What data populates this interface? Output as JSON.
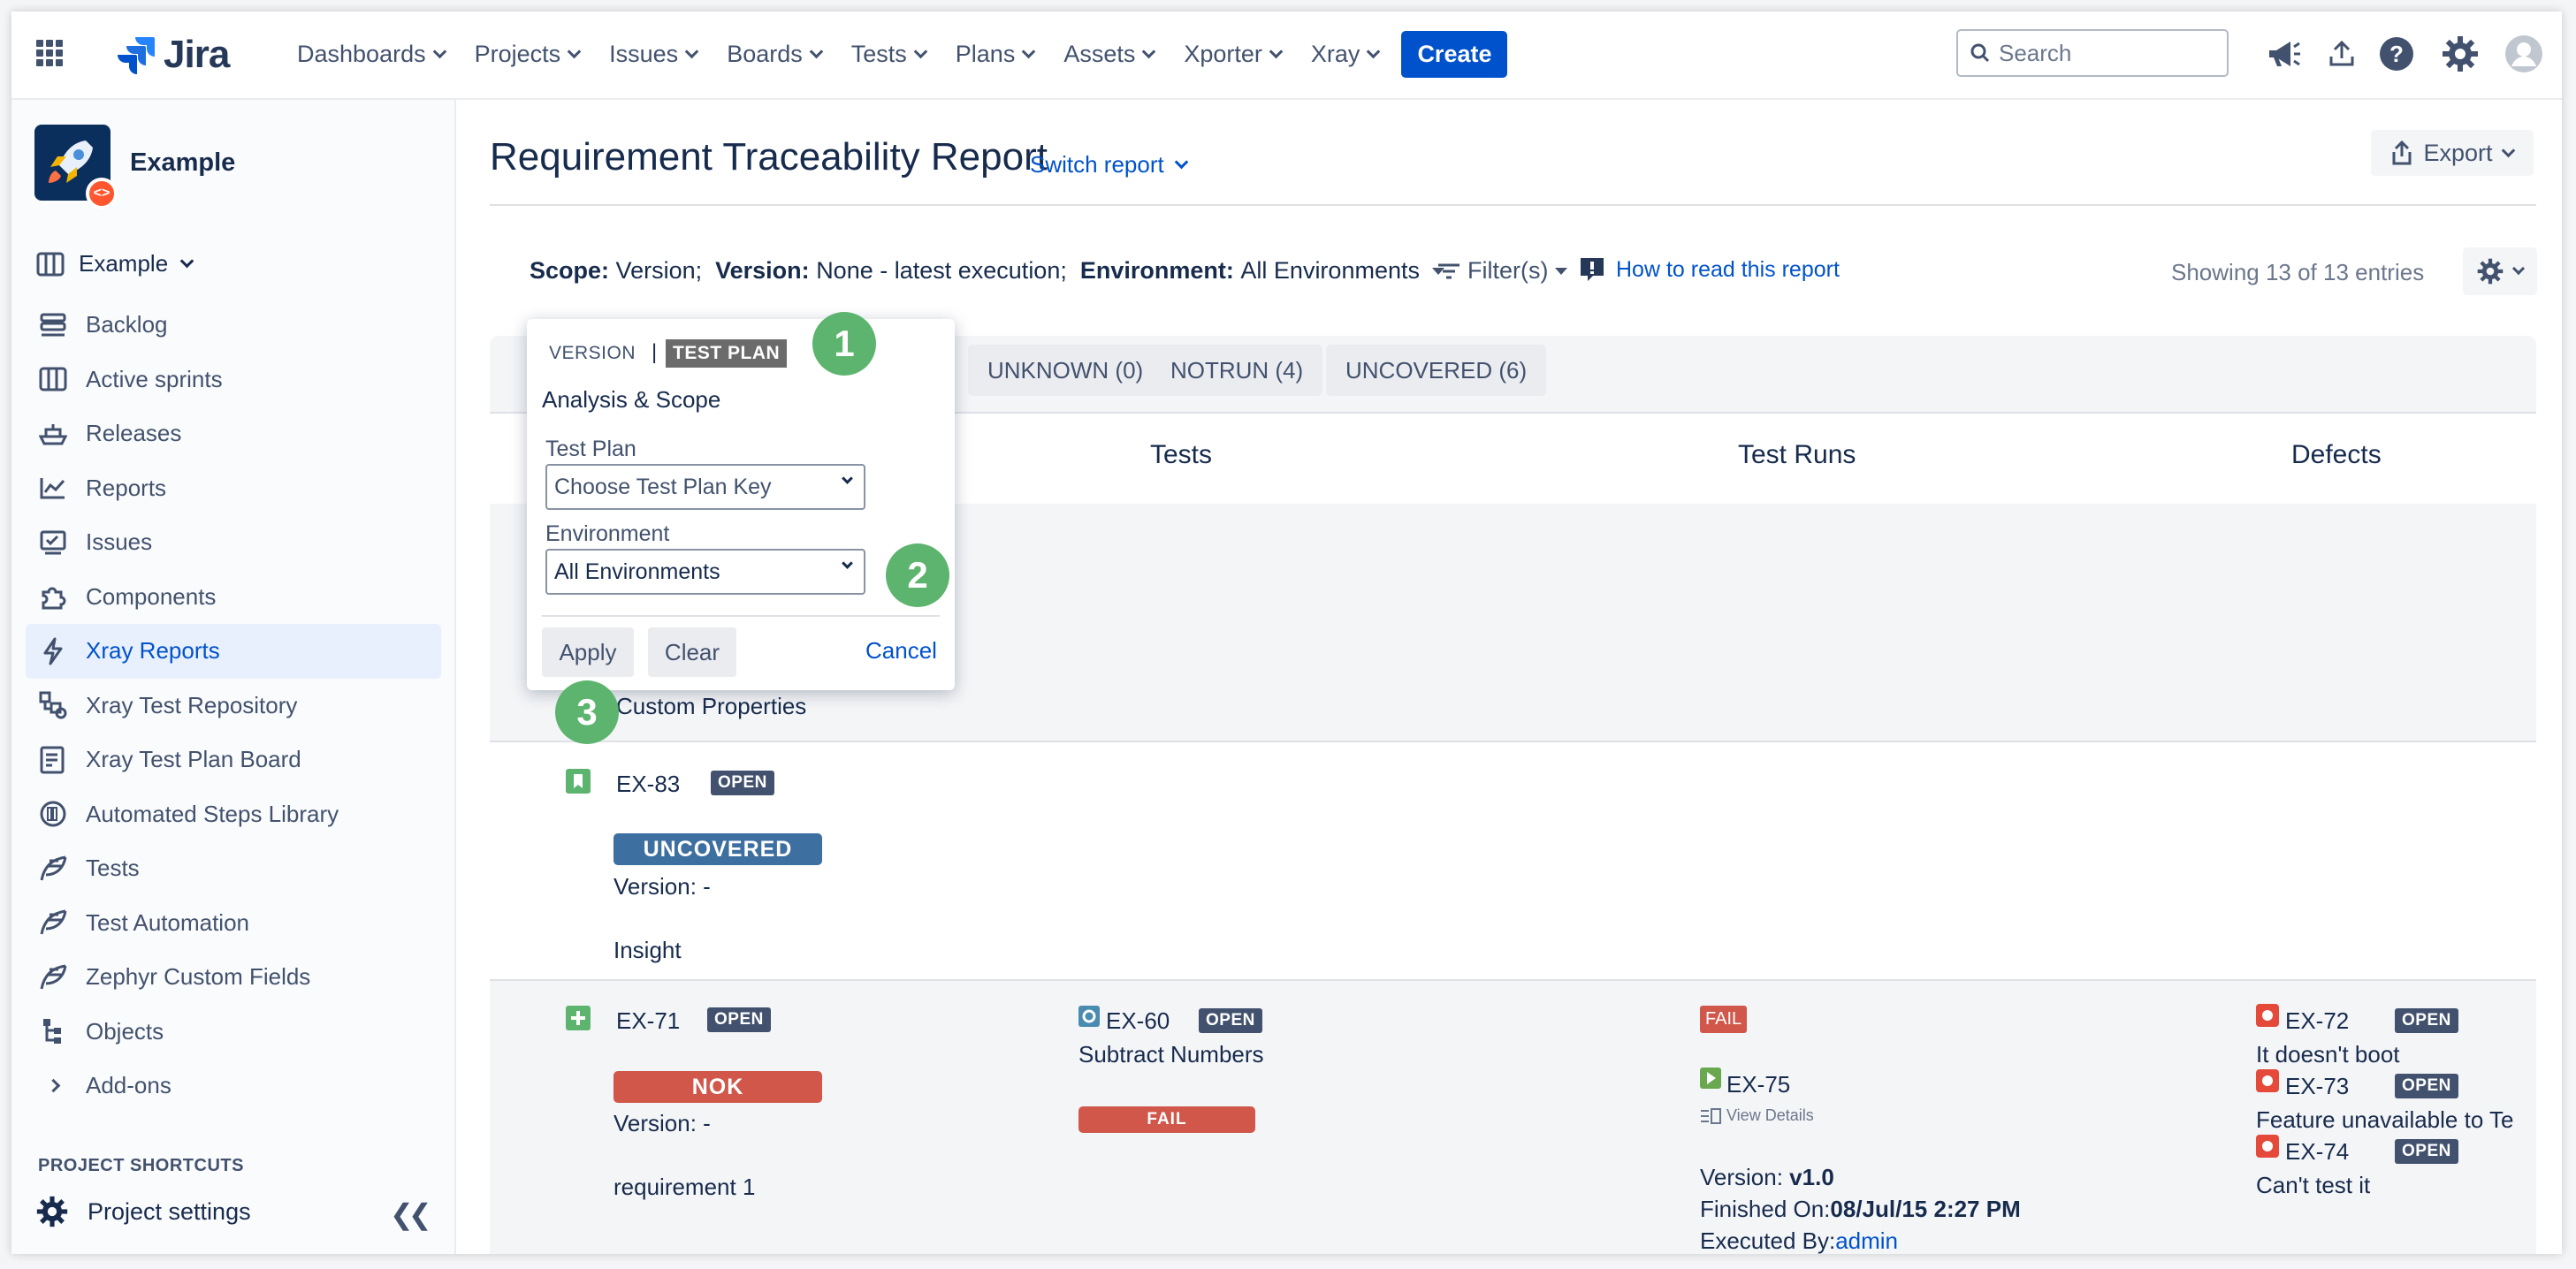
{
  "topbar": {
    "logo_text": "Jira",
    "nav": [
      {
        "label": "Dashboards"
      },
      {
        "label": "Projects"
      },
      {
        "label": "Issues"
      },
      {
        "label": "Boards"
      },
      {
        "label": "Tests"
      },
      {
        "label": "Plans"
      },
      {
        "label": "Assets"
      },
      {
        "label": "Xporter"
      },
      {
        "label": "Xray"
      }
    ],
    "create_label": "Create",
    "search_placeholder": "Search"
  },
  "sidebar": {
    "project_name": "Example",
    "board_selector": "Example",
    "items": [
      {
        "label": "Backlog",
        "icon": "backlog-icon"
      },
      {
        "label": "Active sprints",
        "icon": "board-icon"
      },
      {
        "label": "Releases",
        "icon": "ship-icon"
      },
      {
        "label": "Reports",
        "icon": "chart-icon"
      },
      {
        "label": "Issues",
        "icon": "issues-icon"
      },
      {
        "label": "Components",
        "icon": "puzzle-icon"
      },
      {
        "label": "Xray Reports",
        "icon": "bolt-icon"
      },
      {
        "label": "Xray Test Repository",
        "icon": "repository-icon"
      },
      {
        "label": "Xray Test Plan Board",
        "icon": "plan-board-icon"
      },
      {
        "label": "Automated Steps Library",
        "icon": "library-icon"
      },
      {
        "label": "Tests",
        "icon": "feather-icon"
      },
      {
        "label": "Test Automation",
        "icon": "feather-icon"
      },
      {
        "label": "Zephyr Custom Fields",
        "icon": "feather-icon"
      },
      {
        "label": "Objects",
        "icon": "tree-icon"
      },
      {
        "label": "Add-ons",
        "icon": "chevron-right-icon"
      }
    ],
    "shortcuts_heading": "PROJECT SHORTCUTS",
    "project_settings": "Project settings"
  },
  "report": {
    "title": "Requirement Traceability Report",
    "switch_report": "Switch report",
    "export_label": "Export",
    "scope_label": "Scope:",
    "scope_value": "Version;",
    "version_label": "Version:",
    "version_value": "None - latest execution;",
    "environment_label": "Environment:",
    "environment_value": "All Environments",
    "filters_label": "Filter(s)",
    "how_to_read": "How to read this report",
    "showing": "Showing 13 of 13 entries",
    "tabs": [
      "UNKNOWN (0)",
      "NOTRUN (4)",
      "UNCOVERED (6)"
    ],
    "columns": [
      "Tests",
      "Test Runs",
      "Defects"
    ]
  },
  "popup": {
    "tab_version": "VERSION",
    "separator": "|",
    "tab_test_plan": "TEST PLAN",
    "section_title": "Analysis & Scope",
    "test_plan_label": "Test Plan",
    "test_plan_placeholder": "Choose Test Plan Key",
    "environment_label": "Environment",
    "environment_value": "All Environments",
    "apply": "Apply",
    "clear": "Clear",
    "cancel": "Cancel"
  },
  "callouts": [
    "1",
    "2",
    "3"
  ],
  "custom_properties": "Custom Properties",
  "rows": [
    {
      "key": "EX-83",
      "status": "OPEN",
      "coverage": "UNCOVERED",
      "version": "Version: -",
      "summary": "Insight"
    },
    {
      "key": "EX-71",
      "status": "OPEN",
      "coverage": "NOK",
      "version": "Version: -",
      "summary": "requirement 1",
      "test": {
        "key": "EX-60",
        "status": "OPEN",
        "summary": "Subtract Numbers",
        "result": "FAIL"
      },
      "run": {
        "result": "FAIL",
        "key": "EX-75",
        "view_details": "View Details",
        "version_label": "Version: ",
        "version_value": "v1.0",
        "finished_label": "Finished On:",
        "finished_value": "08/Jul/15 2:27 PM",
        "executed_label": "Executed By:",
        "executed_value": "admin"
      },
      "defects": [
        {
          "key": "EX-72",
          "status": "OPEN",
          "summary": "It doesn't boot"
        },
        {
          "key": "EX-73",
          "status": "OPEN",
          "summary": "Feature unavailable to Te"
        },
        {
          "key": "EX-74",
          "status": "OPEN",
          "summary": "Can't test it"
        }
      ]
    }
  ],
  "colors": {
    "accent": "#0052cc",
    "uncovered": "#3d6fa1",
    "nok": "#d0574a",
    "fail": "#d0574a",
    "callout": "#5db46e"
  }
}
